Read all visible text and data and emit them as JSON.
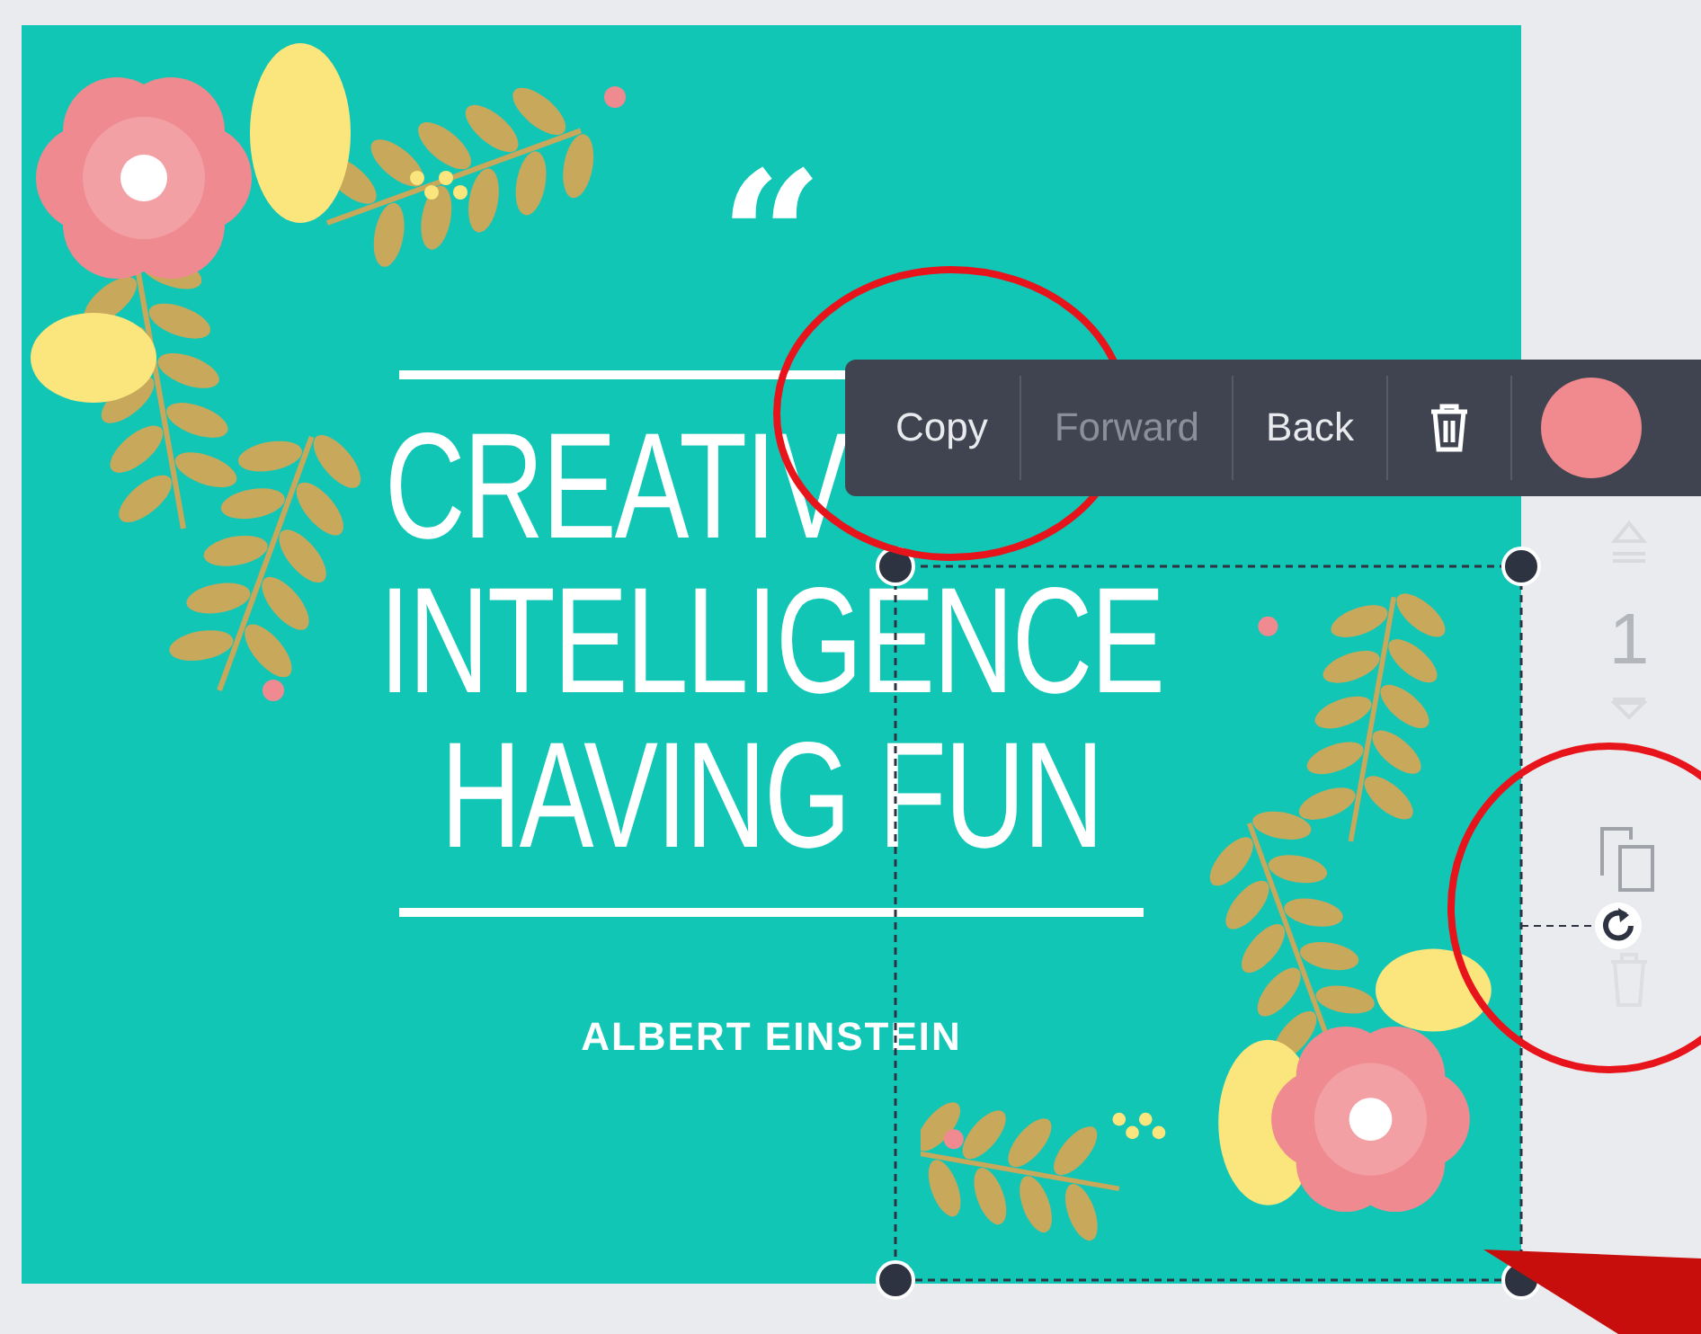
{
  "design": {
    "quote_mark": "“",
    "headline": [
      "CREATIV",
      "INTELLIGENCE",
      "HAVING FUN"
    ],
    "author": "ALBERT EINSTEIN"
  },
  "toolbar": {
    "items": [
      {
        "kind": "text",
        "label": "Copy",
        "disabled": false
      },
      {
        "kind": "text",
        "label": "Forward",
        "disabled": true
      },
      {
        "kind": "text",
        "label": "Back",
        "disabled": false
      },
      {
        "kind": "delete"
      },
      {
        "kind": "color",
        "color": "#f08a8e"
      }
    ]
  },
  "page_side": {
    "page_number": "1"
  }
}
